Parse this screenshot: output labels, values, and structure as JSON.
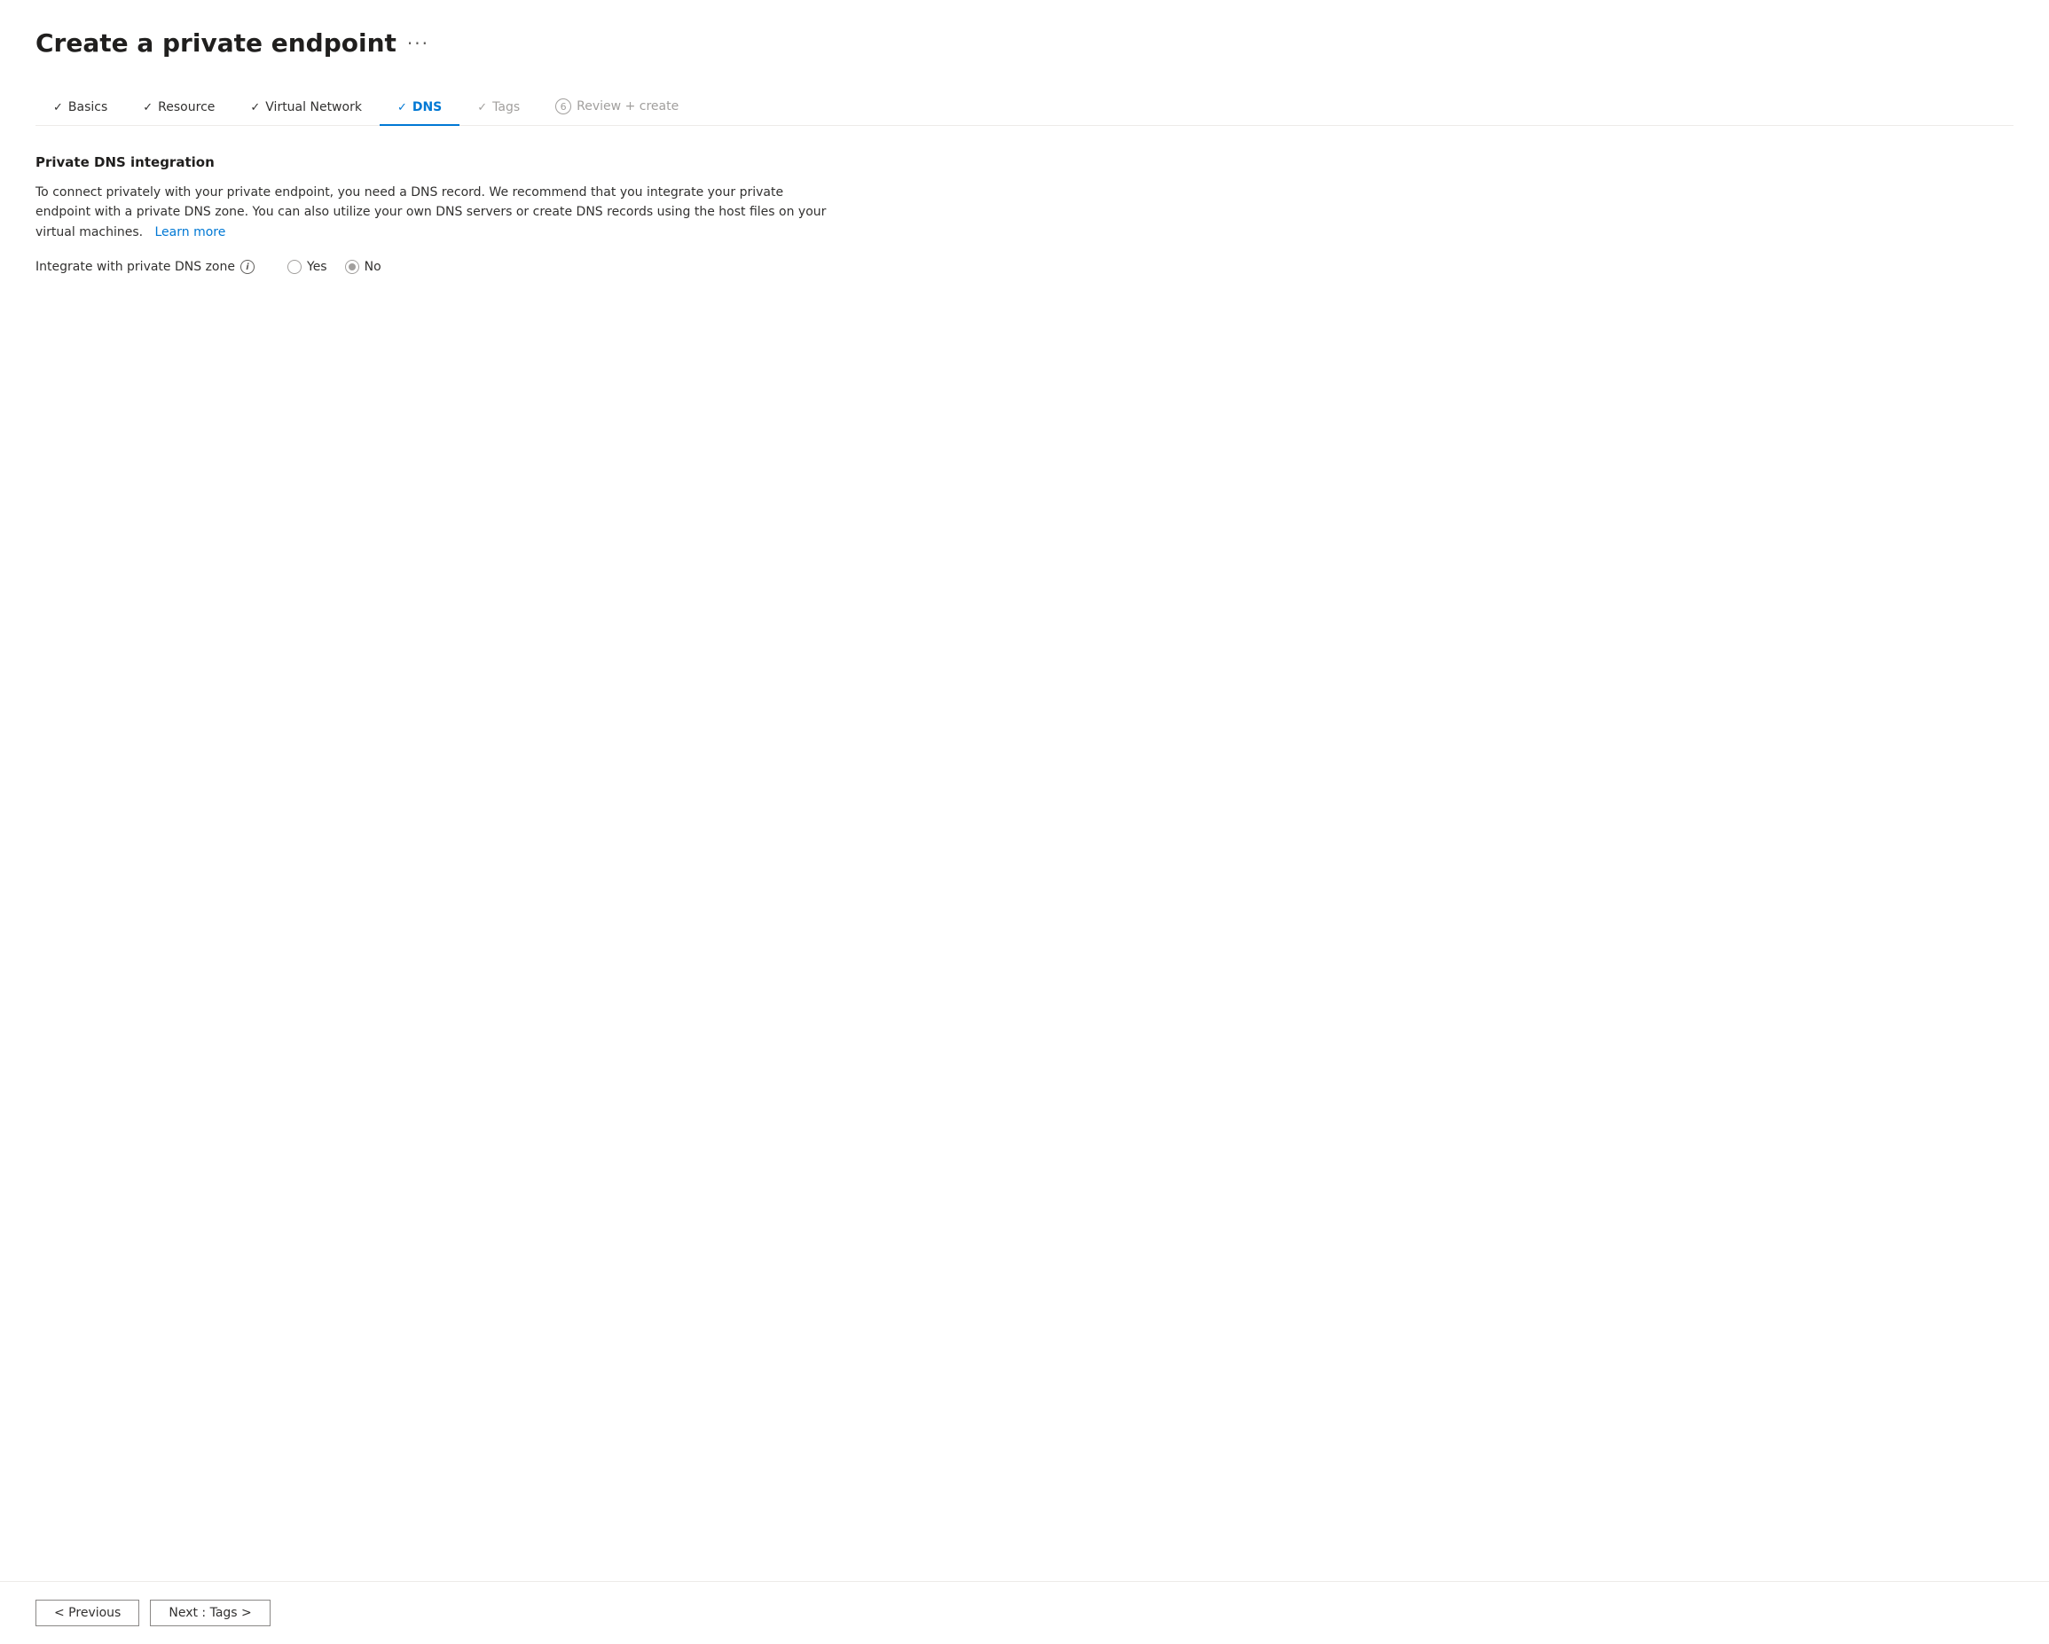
{
  "page": {
    "title": "Create a private endpoint",
    "more_options_icon": "···"
  },
  "tabs": [
    {
      "id": "basics",
      "label": "Basics",
      "state": "completed",
      "step": null
    },
    {
      "id": "resource",
      "label": "Resource",
      "state": "completed",
      "step": null
    },
    {
      "id": "virtual_network",
      "label": "Virtual Network",
      "state": "completed",
      "step": null
    },
    {
      "id": "dns",
      "label": "DNS",
      "state": "active",
      "step": null
    },
    {
      "id": "tags",
      "label": "Tags",
      "state": "disabled",
      "step": null
    },
    {
      "id": "review_create",
      "label": "Review + create",
      "state": "disabled",
      "step": "6"
    }
  ],
  "content": {
    "section_title": "Private DNS integration",
    "description": "To connect privately with your private endpoint, you need a DNS record. We recommend that you integrate your private endpoint with a private DNS zone. You can also utilize your own DNS servers or create DNS records using the host files on your virtual machines.",
    "learn_more_label": "Learn more",
    "form": {
      "label": "Integrate with private DNS zone",
      "info_icon_label": "i",
      "options": [
        {
          "id": "yes",
          "label": "Yes",
          "selected": false
        },
        {
          "id": "no",
          "label": "No",
          "selected": true
        }
      ]
    }
  },
  "footer": {
    "previous_label": "< Previous",
    "next_label": "Next : Tags >"
  }
}
